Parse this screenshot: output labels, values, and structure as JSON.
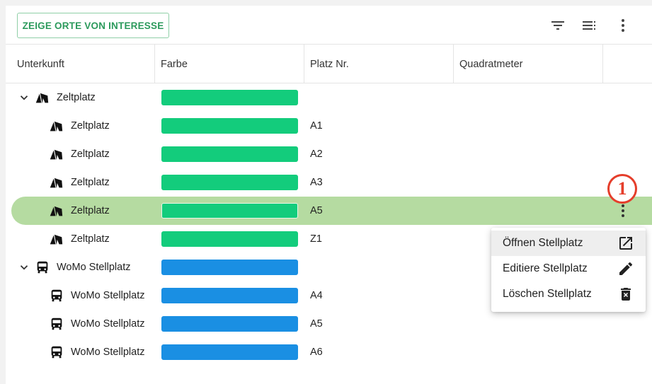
{
  "toolbar": {
    "poi_button_label": "ZEIGE ORTE VON INTERESSE",
    "icons": [
      "filter-icon",
      "list-settings-icon",
      "more-vert-icon"
    ]
  },
  "columns": [
    "Unterkunft",
    "Farbe",
    "Platz Nr.",
    "Quadratmeter"
  ],
  "colors": {
    "accent": "#2c9a5c",
    "zeltplatz_bar": "#13cc7c",
    "womo_bar": "#1a8fe3",
    "selected_row": "#b5dba1",
    "annotation": "#e53e2b"
  },
  "groups": [
    {
      "label": "Zeltplatz",
      "icon": "tent-icon",
      "expanded": true,
      "children": [
        {
          "label": "Zeltplatz",
          "platz_nr": "A1"
        },
        {
          "label": "Zeltplatz",
          "platz_nr": "A2"
        },
        {
          "label": "Zeltplatz",
          "platz_nr": "A3"
        },
        {
          "label": "Zeltplatz",
          "platz_nr": "A5",
          "selected": true
        },
        {
          "label": "Zeltplatz",
          "platz_nr": "Z1"
        }
      ]
    },
    {
      "label": "WoMo Stellplatz",
      "icon": "bus-icon",
      "expanded": true,
      "children": [
        {
          "label": "WoMo Stellplatz",
          "platz_nr": "A4"
        },
        {
          "label": "WoMo Stellplatz",
          "platz_nr": "A5"
        },
        {
          "label": "WoMo Stellplatz",
          "platz_nr": "A6"
        }
      ]
    }
  ],
  "annotation": {
    "number": "1"
  },
  "context_menu": {
    "items": [
      {
        "label": "Öffnen Stellplatz",
        "icon": "open-in-new-icon"
      },
      {
        "label": "Editiere Stellplatz",
        "icon": "edit-pencil-icon"
      },
      {
        "label": "Löschen Stellplatz",
        "icon": "delete-icon"
      }
    ]
  }
}
